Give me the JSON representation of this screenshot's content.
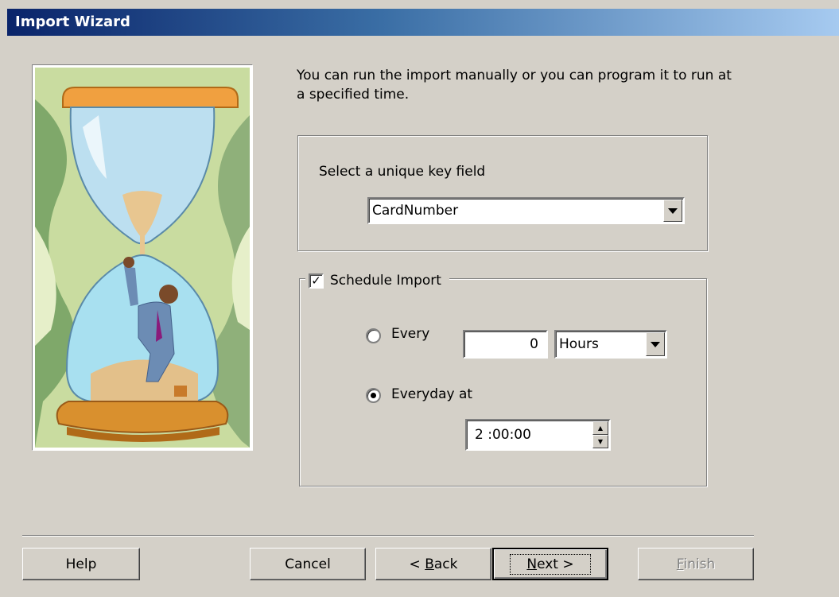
{
  "window": {
    "title": "Import Wizard"
  },
  "intro_text": "You can run the import manually or you can program it to run at a specified time.",
  "key_field": {
    "label": "Select a unique key field",
    "selected": "CardNumber"
  },
  "schedule": {
    "checkbox_label": "Schedule Import",
    "checked": true,
    "every_label": "Every",
    "every_value": "0",
    "unit_selected": "Hours",
    "everyday_label": "Everyday at",
    "time_value": "2 :00:00",
    "selected_option": "everyday"
  },
  "buttons": {
    "help": "Help",
    "cancel": "Cancel",
    "back_prefix": "< ",
    "back_mnemonic": "B",
    "back_rest": "ack",
    "next_mnemonic": "N",
    "next_rest": "ext >",
    "finish_mnemonic": "F",
    "finish_rest": "inish"
  },
  "icons": [
    "hourglass-illustration",
    "dropdown-arrow-icon",
    "checkmark-icon",
    "spin-up-icon",
    "spin-down-icon"
  ]
}
